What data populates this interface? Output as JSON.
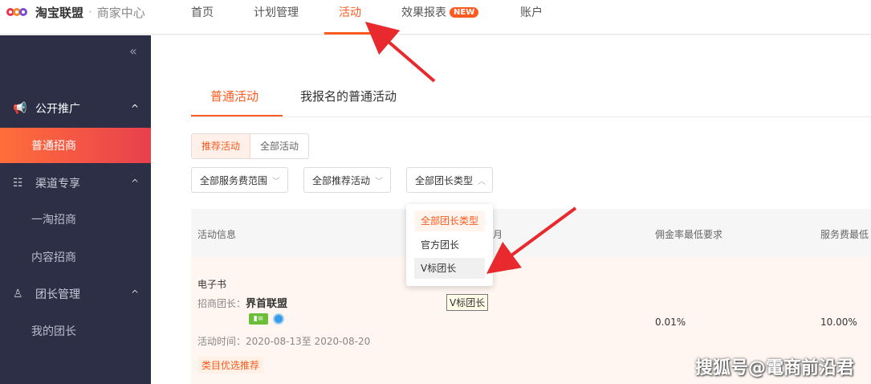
{
  "header": {
    "brand": "淘宝联盟",
    "sep": "·",
    "sub": "商家中心",
    "nav": [
      {
        "label": "首页"
      },
      {
        "label": "计划管理"
      },
      {
        "label": "活动"
      },
      {
        "label": "效果报表",
        "badge": "NEW"
      },
      {
        "label": "账户"
      }
    ],
    "active_nav": "活动",
    "accent": "#ff5a1f"
  },
  "sidebar": {
    "collapse_icon": "«",
    "groups": [
      {
        "icon": "megaphone-icon",
        "glyph": "📢",
        "label": "公开推广",
        "chevron": "^"
      },
      {
        "icon": "sitemap-icon",
        "glyph": "☷",
        "label": "渠道专享",
        "chevron": "^"
      },
      {
        "icon": "user-icon",
        "glyph": "♙",
        "label": "团长管理",
        "chevron": "^"
      }
    ],
    "items": [
      {
        "label": "普通招商",
        "active": true
      },
      {
        "label": "一淘招商"
      },
      {
        "label": "内容招商"
      },
      {
        "label": "我的团长"
      }
    ]
  },
  "main": {
    "tabs": [
      {
        "label": "普通活动",
        "active": true
      },
      {
        "label": "我报名的普通活动"
      }
    ],
    "segment": [
      "推荐活动",
      "全部活动"
    ],
    "filters": [
      {
        "label": "全部服务费范围"
      },
      {
        "label": "全部推荐活动"
      },
      {
        "label": "全部团长类型"
      }
    ],
    "dropdown": {
      "options": [
        "全部团长类型",
        "官方团长",
        "V标团长"
      ],
      "selected": "全部团长类型",
      "hover": "V标团长"
    },
    "table": {
      "headers": [
        "活动信息",
        "佣金率最低要求",
        "服务费最低"
      ],
      "hidden_header_fragment": "月",
      "row": {
        "category": "电子书",
        "leader_label": "招商团长：",
        "leader_name": "界首联盟",
        "time": "活动时间：2020-08-13至 2020-08-20",
        "tag": "类目优选推荐",
        "commission": "0.01%",
        "service_fee": "10.00%"
      }
    },
    "tooltip": "V标团长"
  },
  "watermark": "搜狐号@電商前沿君"
}
